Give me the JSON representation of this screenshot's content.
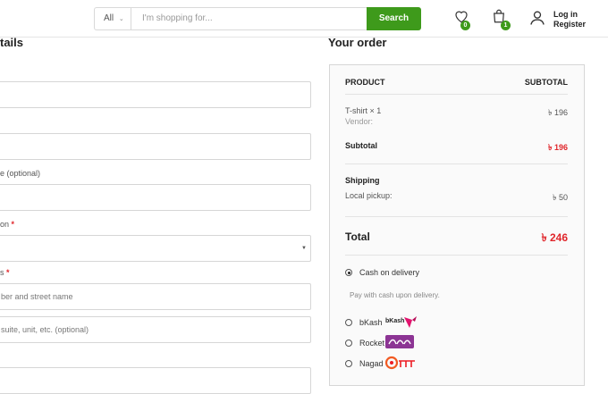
{
  "header": {
    "category": "All",
    "search_placeholder": "I'm shopping for...",
    "search_button": "Search",
    "wishlist_count": "0",
    "cart_count": "1",
    "login": "Log in",
    "register": "Register"
  },
  "billing": {
    "title": "tails",
    "label_company": "e (optional)",
    "label_region": "on",
    "label_street": "s",
    "street_placeholder": "ber and street name",
    "apartment_placeholder": "suite, unit, etc. (optional)",
    "required_mark": "*"
  },
  "order": {
    "title": "Your order",
    "col_product": "PRODUCT",
    "col_subtotal": "SUBTOTAL",
    "item_name": "T-shirt  × 1",
    "item_vendor": "Vendor:",
    "item_price": "৳ 196",
    "subtotal_label": "Subtotal",
    "subtotal_value": "৳ 196",
    "shipping_label": "Shipping",
    "shipping_method": "Local pickup:",
    "shipping_value": "৳ 50",
    "total_label": "Total",
    "total_value": "৳ 246"
  },
  "payment": {
    "cod": "Cash on delivery",
    "cod_desc": "Pay with cash upon delivery.",
    "bkash": "bKash",
    "bkash_logo_text": "bKash",
    "rocket": "Rocket",
    "nagad": "Nagad",
    "selected": "cod"
  }
}
